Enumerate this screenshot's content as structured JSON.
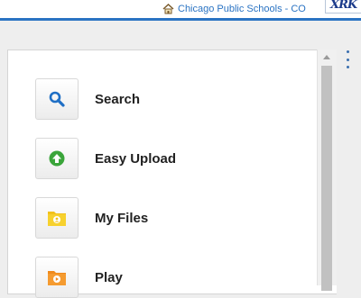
{
  "header": {
    "school_name": "Chicago Public Schools - CO",
    "home_icon": "home-icon",
    "logo_text": "XRK",
    "accent_color": "#2a73c3"
  },
  "menu": {
    "items": [
      {
        "label": "Search",
        "icon": "magnifier-icon",
        "color": "#1f6fc5"
      },
      {
        "label": "Easy Upload",
        "icon": "upload-icon",
        "color": "#3aa53a"
      },
      {
        "label": "My Files",
        "icon": "folder-icon",
        "color": "#f2c21b"
      },
      {
        "label": "Play",
        "icon": "play-folder-icon",
        "color": "#f08a1c"
      }
    ]
  }
}
